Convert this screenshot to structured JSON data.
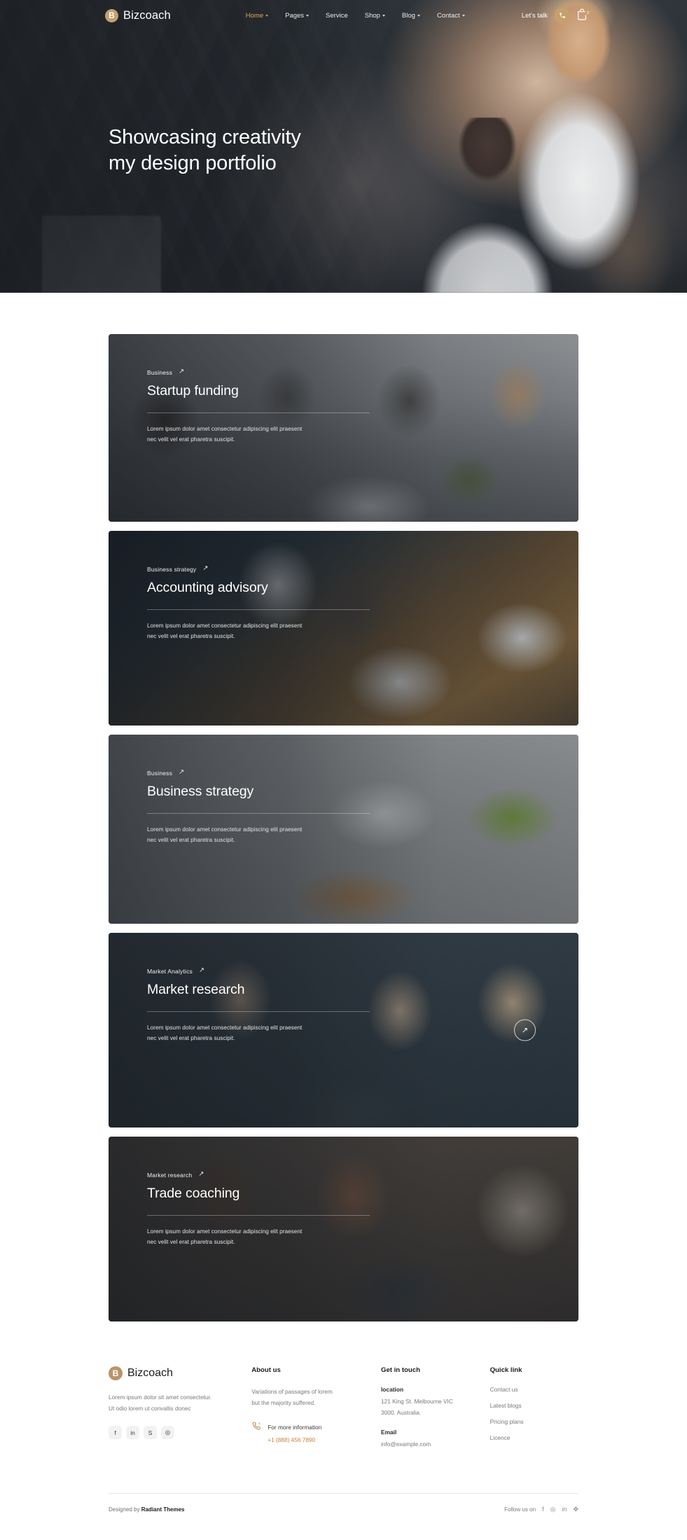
{
  "nav": {
    "brand": {
      "mark": "B",
      "name": "Bizcoach"
    },
    "menu": [
      {
        "label": "Home",
        "caret": true,
        "active": true
      },
      {
        "label": "Pages",
        "caret": true,
        "active": false
      },
      {
        "label": "Service",
        "caret": false,
        "active": false
      },
      {
        "label": "Shop",
        "caret": true,
        "active": false
      },
      {
        "label": "Blog",
        "caret": true,
        "active": false
      },
      {
        "label": "Contact",
        "caret": true,
        "active": false
      }
    ],
    "cta_label": "Let's talk",
    "phone_icon": "phone-icon",
    "cart_icon": "shopping-bag-icon",
    "cart_count": "2",
    "accent": "#c79f6d"
  },
  "hero": {
    "title_line1": "Showcasing creativity",
    "title_line2": "my design portfolio"
  },
  "portfolio": {
    "cards": [
      {
        "category": "Business",
        "title": "Startup funding",
        "desc_line1": "Lorem ipsum dolor amet consectetur adipiscing elit praesent",
        "desc_line2": "nec velit vel erat pharetra suscipit.",
        "arrow": "↗",
        "has_circle_button": false
      },
      {
        "category": "Business strategy",
        "title": "Accounting advisory",
        "desc_line1": "Lorem ipsum dolor amet consectetur adipiscing elit praesent",
        "desc_line2": "nec velit vel erat pharetra suscipit.",
        "arrow": "↗",
        "has_circle_button": false
      },
      {
        "category": "Business",
        "title": "Business strategy",
        "desc_line1": "Lorem ipsum dolor amet consectetur adipiscing elit praesent",
        "desc_line2": "nec velit vel erat pharetra suscipit.",
        "arrow": "↗",
        "has_circle_button": false
      },
      {
        "category": "Market Analytics",
        "title": "Market research",
        "desc_line1": "Lorem ipsum dolor amet consectetur adipiscing elit praesent",
        "desc_line2": "nec velit vel erat pharetra suscipit.",
        "arrow": "↗",
        "has_circle_button": true,
        "circle_arrow": "↗"
      },
      {
        "category": "Market research",
        "title": "Trade coaching",
        "desc_line1": "Lorem ipsum dolor amet consectetur adipiscing elit praesent",
        "desc_line2": "nec velit vel erat pharetra suscipit.",
        "arrow": "↗",
        "has_circle_button": false
      }
    ]
  },
  "footer": {
    "brand": {
      "mark": "B",
      "name": "Bizcoach"
    },
    "brand_desc_line1": "Lorem ipsum dolor sit amet consectetur.",
    "brand_desc_line2": "Ut odio lorem ut convallis donec",
    "socials": [
      {
        "name": "facebook-icon",
        "glyph": "f"
      },
      {
        "name": "linkedin-icon",
        "glyph": "in"
      },
      {
        "name": "skype-icon",
        "glyph": "S"
      },
      {
        "name": "instagram-icon",
        "glyph": "◎"
      }
    ],
    "about": {
      "heading": "About us",
      "text_line1": "Variations of passages of lorem",
      "text_line2": "but the majority suffered.",
      "phone_label": "For more information",
      "phone_number": "+1 (888) 456 7890",
      "phone_icon": "phone-ring-icon",
      "phone_color": "#c97f3a"
    },
    "touch": {
      "heading": "Get in touch",
      "location_label": "location",
      "location_line1": "121 King St. Melbourne VIC",
      "location_line2": "3000. Australia.",
      "email_label": "Email",
      "email_value": "info@example.com"
    },
    "quick": {
      "heading": "Quick link",
      "links": [
        "Contact us",
        "Latest blogs",
        "Pricing plans",
        "Licence"
      ]
    },
    "bottom": {
      "designed_prefix": "Designed by ",
      "designed_by": "Radiant Themes",
      "follow_label": "Follow us on",
      "icons": [
        {
          "name": "facebook-icon",
          "glyph": "f"
        },
        {
          "name": "instagram-icon",
          "glyph": "◎"
        },
        {
          "name": "linkedin-icon",
          "glyph": "in"
        },
        {
          "name": "dribbble-icon",
          "glyph": "✥"
        }
      ]
    }
  }
}
